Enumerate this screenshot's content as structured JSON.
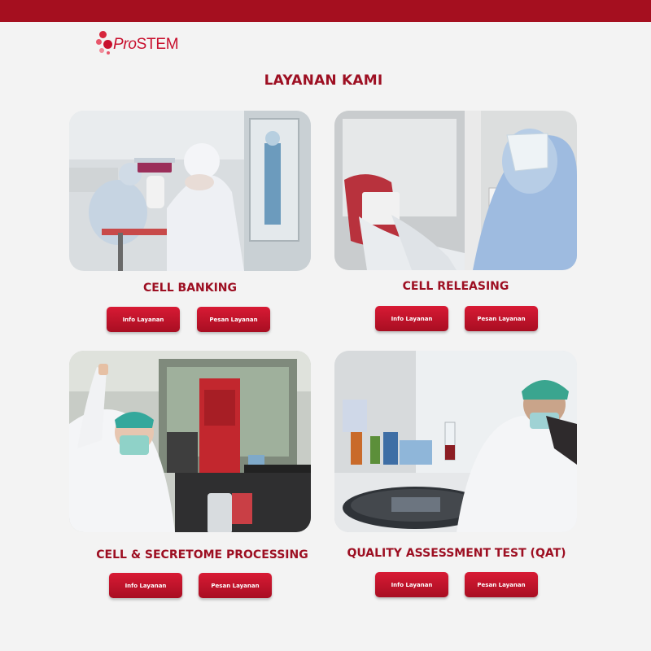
{
  "header": {
    "logo_text_pro": "Pro",
    "logo_text_stem": "STEM"
  },
  "section_title": "LAYANAN KAMI",
  "services": [
    {
      "title": "CELL BANKING",
      "info_label": "Info Layanan",
      "order_label": "Pesan Layanan"
    },
    {
      "title": "CELL RELEASING",
      "info_label": "Info Layanan",
      "order_label": "Pesan Layanan"
    },
    {
      "title": "CELL & SECRETOME PROCESSING",
      "info_label": "Info Layanan",
      "order_label": "Pesan Layanan"
    },
    {
      "title": "QUALITY ASSESSMENT TEST (QAT)",
      "info_label": "Info Layanan",
      "order_label": "Pesan Layanan"
    }
  ],
  "colors": {
    "brand": "#a50f1f",
    "title": "#9d0f22",
    "button": "#c8142c",
    "background": "#f3f3f3"
  }
}
